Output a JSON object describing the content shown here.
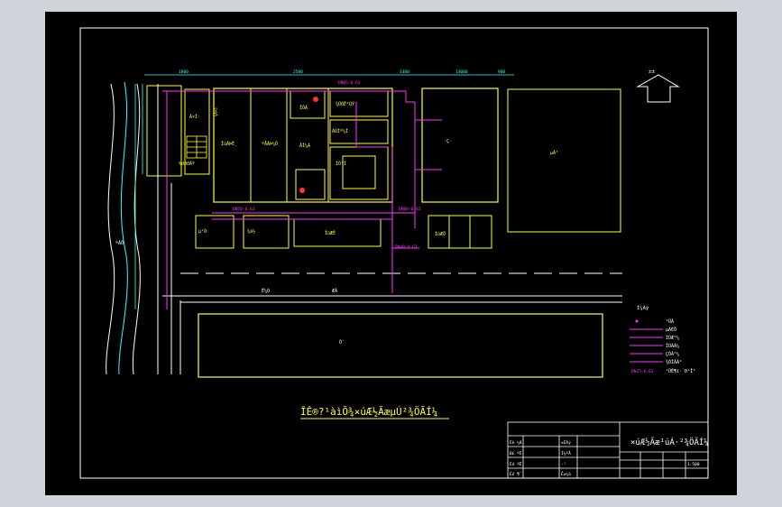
{
  "drawing": {
    "title": "ÎÊ®?¹àìÕ¾×úÆ½ÃæµÚ²¾ÖÃÍ¼",
    "north_label": "±±",
    "stamp_title": "×úÆ½Ãæ¹úÁ·²¾ÖÃÍ¼",
    "scale": "1:500",
    "block_labels": {
      "a": "Ã×Ì·",
      "b": "¾Áºö",
      "c": "%d00Ãº",
      "d": "ÎüÃÞÊ¸",
      "e": "ºÅÃÞ¼Ô",
      "f": "ÏÒÃ",
      "g": "ÅÎ¼Á",
      "h": "¾ÛÓÊ²ÚÝ",
      "i": "ÀÚÌº¼Í",
      "j": "ÍÕ¹Í",
      "k": "·Ç·",
      "l": "µÃ³",
      "m": "µ¹Ó",
      "n": "¾á½",
      "o": "ÎüÆÊ",
      "p": "ÍúÆÖ",
      "q": "Ö¯",
      "r": "ºÂÖ",
      "s": "Ë¼Ò",
      "t": "ÆÂ",
      "u": "ÏÖÃÔ¹",
      "v": "ÍÁ²¼±",
      "w": "ÃÕ¼Ö",
      "x": "·¹"
    },
    "pipe_labels": [
      "DN65-0.63",
      "DN50-0.63",
      "DN80-0.63",
      "DN40-0.63"
    ],
    "dim_labels": [
      "1800",
      "2500",
      "1400",
      "14000",
      "900",
      "4000"
    ],
    "legend": {
      "title": "Í¼Àý",
      "items": [
        {
          "symbol": "o",
          "label": "¹ÜÂ"
        },
        {
          "symbol": "—",
          "label": "µÃÉÖ"
        },
        {
          "symbol": "—",
          "label": "ÍÚÆ°¼"
        },
        {
          "symbol": "—",
          "label": "ÍÚÃÃ¼"
        },
        {
          "symbol": "—",
          "label": "ÇÓÃ°¼"
        },
        {
          "symbol": "—",
          "label": "¾ÓÎÂÃ°"
        },
        {
          "symbol": "DN25-0.63",
          "label": "¹ÜÊ¶ï·´Ð¹Î²"
        }
      ]
    },
    "title_block": {
      "left_rows": [
        "Éè ¼Æ",
        "Ð£ ºË",
        "Éó ºË",
        "Éó ¶¨"
      ],
      "right_rows": [
        "±ÈÀý",
        "Í¼ºÅ",
        "·¹",
        "Ê±¼ä"
      ]
    },
    "colors": {
      "background": "#000000",
      "frame": "#ffffff",
      "building": "#ffff33",
      "pipe": "#ff33ff",
      "dimension": "#33ffff",
      "road": "#ffffff"
    }
  }
}
